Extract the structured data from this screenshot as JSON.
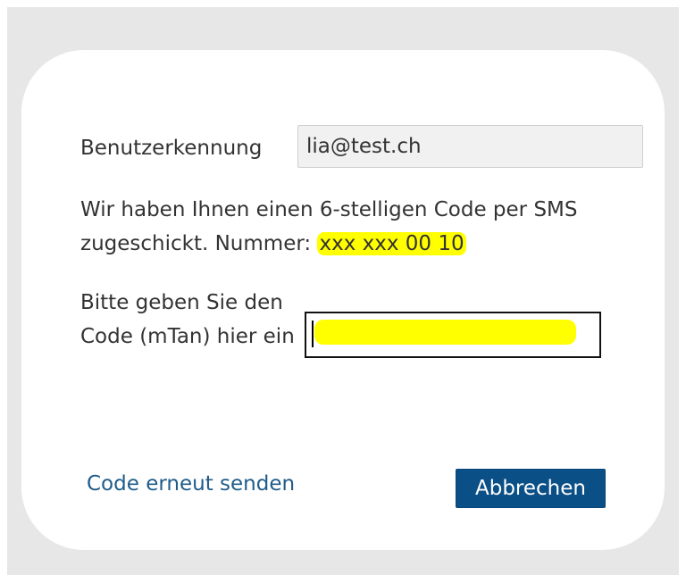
{
  "form": {
    "user_label": "Benutzerkennung",
    "user_value": "lia@test.ch",
    "message_text": "Wir haben Ihnen einen 6-stelligen Code per SMS zugeschickt. Nummer: ",
    "masked_number": "xxx xxx 00 10",
    "code_label": "Bitte geben Sie den Code (mTan) hier ein",
    "code_value": ""
  },
  "actions": {
    "resend_label": "Code erneut senden",
    "cancel_label": "Abbrechen"
  },
  "colors": {
    "background": "#e6e7e6",
    "card": "#ffffff",
    "highlight": "#ffff00",
    "link": "#1f5c8a",
    "button": "#0b4f87"
  }
}
